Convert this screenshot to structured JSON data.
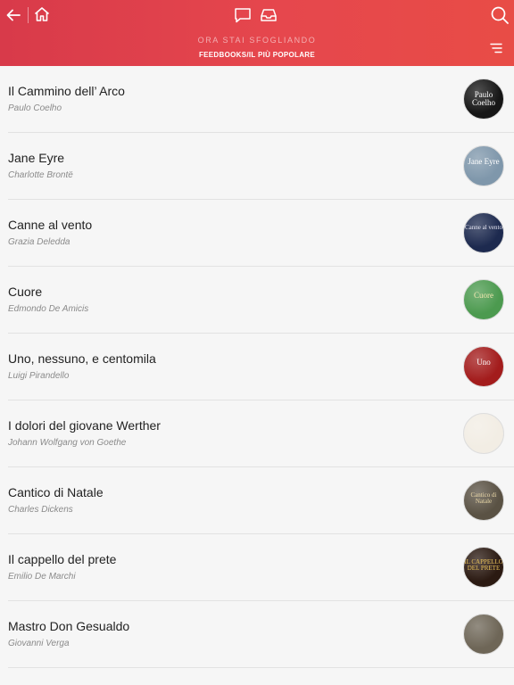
{
  "header": {
    "browse_label": "ORA STAI SFOGLIANDO",
    "browse_path": "FEEDBOOKS/IL PIÙ POPOLARE"
  },
  "books": [
    {
      "title": "Il Cammino dell’ Arco",
      "author": "Paulo Coelho",
      "cover_text": "Paulo Coelho",
      "cover_bg": "#161616",
      "cover_fg": "#ffffff"
    },
    {
      "title": "Jane Eyre",
      "author": "Charlotte Brontë",
      "cover_text": "Jane Eyre",
      "cover_bg": "#7f97ab",
      "cover_fg": "#ffffff"
    },
    {
      "title": "Canne al vento",
      "author": "Grazia Deledda",
      "cover_text": "Canne al vento",
      "cover_bg": "#1d2a4f",
      "cover_fg": "#e6e6f2"
    },
    {
      "title": "Cuore",
      "author": "Edmondo De Amicis",
      "cover_text": "Cuore",
      "cover_bg": "#4c9a4f",
      "cover_fg": "#f2e7b0"
    },
    {
      "title": "Uno, nessuno, e centomila",
      "author": "Luigi Pirandello",
      "cover_text": "Uno",
      "cover_bg": "#a31c1c",
      "cover_fg": "#ffffff"
    },
    {
      "title": "I dolori del giovane Werther",
      "author": "Johann Wolfgang von Goethe",
      "cover_text": "",
      "cover_bg": "#f2ede4",
      "cover_fg": "#6b3a1a"
    },
    {
      "title": "Cantico di Natale",
      "author": "Charles Dickens",
      "cover_text": "Cantico di Natale",
      "cover_bg": "#5a5244",
      "cover_fg": "#ead8a8"
    },
    {
      "title": "Il cappello del prete",
      "author": "Emilio De Marchi",
      "cover_text": "IL CAPPELLO DEL PRETE",
      "cover_bg": "#2b1a12",
      "cover_fg": "#e9c25a"
    },
    {
      "title": "Mastro Don Gesualdo",
      "author": "Giovanni Verga",
      "cover_text": "",
      "cover_bg": "#6e6657",
      "cover_fg": "#eee2c4"
    }
  ]
}
